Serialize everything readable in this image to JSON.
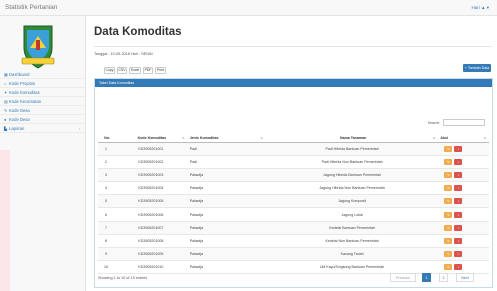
{
  "app": {
    "brand": "Statistik Pertanian",
    "user_menu": "Hari ▲ ▾"
  },
  "sidebar": {
    "items": [
      {
        "icon": "dashboard-icon",
        "glyph": "▦",
        "label": "Dashboard"
      },
      {
        "icon": "home-icon",
        "glyph": "⌂",
        "label": "Kode Propinsi"
      },
      {
        "icon": "leaf-icon",
        "glyph": "✦",
        "label": "Kode Komoditas"
      },
      {
        "icon": "list-icon",
        "glyph": "▤",
        "label": "Kode Kecamatan"
      },
      {
        "icon": "edit-icon",
        "glyph": "✎",
        "label": "Kode Desa"
      },
      {
        "icon": "user-icon",
        "glyph": "●",
        "label": "Kode Desa"
      },
      {
        "icon": "report-icon",
        "glyph": "▙",
        "label": "Laporan"
      }
    ]
  },
  "main": {
    "title": "Data Komoditas",
    "date_line": "Tanggal : 10-09-2018 Hari : SENIN",
    "add_button": "+ Tambah Data",
    "panel_title": "Tabel Data Komoditas",
    "export_buttons": [
      "Copy",
      "CSV",
      "Excel",
      "PDF",
      "Print"
    ],
    "search_label": "Search:",
    "search_value": "",
    "columns": [
      "No.",
      "Kode Komoditas",
      "Jenis Komoditas",
      "Nama Tanaman",
      "Aksi"
    ],
    "rows": [
      {
        "no": "1",
        "kode": "KD3905201001",
        "jenis": "Padi",
        "nama": "Padi Hibrida Bantuan Pemerintah"
      },
      {
        "no": "2",
        "kode": "KD3905201002",
        "jenis": "Padi",
        "nama": "Padi Hibrida Non Bantuan Pemerintah"
      },
      {
        "no": "3",
        "kode": "KD3905201003",
        "jenis": "Palawija",
        "nama": "Jagung Hibrida Bantuan Pemerintah"
      },
      {
        "no": "4",
        "kode": "KD3905201004",
        "jenis": "Palawija",
        "nama": "Jagung Hibrida Non Bantuan Pemerintah"
      },
      {
        "no": "5",
        "kode": "KD3905201005",
        "jenis": "Palawija",
        "nama": "Jagung Komposit"
      },
      {
        "no": "6",
        "kode": "KD3905201006",
        "jenis": "Palawija",
        "nama": "Jagung Lokal"
      },
      {
        "no": "7",
        "kode": "KD3905201007",
        "jenis": "Palawija",
        "nama": "Kedelai Bantuan Pemerintah"
      },
      {
        "no": "8",
        "kode": "KD3905201008",
        "jenis": "Palawija",
        "nama": "Kedelai Non Bantuan Pemerintah"
      },
      {
        "no": "9",
        "kode": "KD3905201009",
        "jenis": "Palawija",
        "nama": "Kacang Tanah"
      },
      {
        "no": "10",
        "kode": "KD3905201010",
        "jenis": "Palawija",
        "nama": "Ubi Kayu/Singkong Bantuan Pemerintah"
      }
    ],
    "showing": "Showing 1 to 10 of 15 entries",
    "pagination": {
      "previous": "Previous",
      "pages": [
        "1",
        "2"
      ],
      "next": "Next"
    }
  },
  "colors": {
    "primary": "#337ab7",
    "edit": "#f0ad4e",
    "delete": "#d9534f"
  }
}
